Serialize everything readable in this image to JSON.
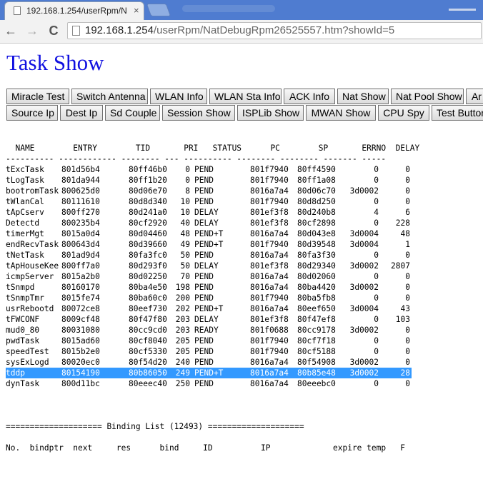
{
  "browser": {
    "tab_title": "192.168.1.254/userRpm/N",
    "tab_close": "×",
    "url_host": "192.168.1.254",
    "url_path": "/userRpm/NatDebugRpm26525557.htm?showId=5",
    "back_glyph": "←",
    "forward_glyph": "→",
    "reload_glyph": "C"
  },
  "page": {
    "title": "Task Show",
    "buttons_row1": [
      "Miracle Test",
      "Switch Antenna",
      "WLAN Info",
      "WLAN Sta Info",
      "ACK Info",
      "Nat Show",
      "Nat Pool Show",
      "Ar"
    ],
    "buttons_row2": [
      "Source Ip",
      "Dest Ip",
      "Sd Couple",
      "Session Show",
      "ISPLib Show",
      "MWAN Show",
      "CPU Spy",
      "Test Button"
    ]
  },
  "task_table": {
    "header": "  NAME        ENTRY        TID       PRI   STATUS      PC        SP       ERRNO  DELAY",
    "separator": "---------- ------------ -------- --- ---------- -------- -------- ------- -----",
    "rows": [
      [
        "tExcTask",
        "801d56b4",
        "80ff46b0",
        "0",
        "PEND",
        "801f7940",
        "80ff4590",
        "0",
        "0"
      ],
      [
        "tLogTask",
        "801da944",
        "80ff1b20",
        "0",
        "PEND",
        "801f7940",
        "80ff1a08",
        "0",
        "0"
      ],
      [
        "bootromTask",
        "800625d0",
        "80d06e70",
        "8",
        "PEND",
        "8016a7a4",
        "80d06c70",
        "3d0002",
        "0"
      ],
      [
        "tWlanCal",
        "80111610",
        "80d8d340",
        "10",
        "PEND",
        "801f7940",
        "80d8d250",
        "0",
        "0"
      ],
      [
        "tApCserv",
        "800ff270",
        "80d241a0",
        "10",
        "DELAY",
        "801ef3f8",
        "80d240b8",
        "4",
        "6"
      ],
      [
        "Detectd",
        "800235b4",
        "80cf2920",
        "40",
        "DELAY",
        "801ef3f8",
        "80cf2898",
        "0",
        "228"
      ],
      [
        "timerMgt",
        "8015a0d4",
        "80d04460",
        "48",
        "PEND+T",
        "8016a7a4",
        "80d043e8",
        "3d0004",
        "48"
      ],
      [
        "endRecvTask",
        "800643d4",
        "80d39660",
        "49",
        "PEND+T",
        "801f7940",
        "80d39548",
        "3d0004",
        "1"
      ],
      [
        "tNetTask",
        "801ad9d4",
        "80fa3fc0",
        "50",
        "PEND",
        "8016a7a4",
        "80fa3f30",
        "0",
        "0"
      ],
      [
        "tApHouseKee",
        "800ff7a0",
        "80d293f0",
        "50",
        "DELAY",
        "801ef3f8",
        "80d29340",
        "3d0002",
        "2807"
      ],
      [
        "icmpServer",
        "8015a2b0",
        "80d02250",
        "70",
        "PEND",
        "8016a7a4",
        "80d02060",
        "0",
        "0"
      ],
      [
        "tSnmpd",
        "80160170",
        "80ba4e50",
        "198",
        "PEND",
        "8016a7a4",
        "80ba4420",
        "3d0002",
        "0"
      ],
      [
        "tSnmpTmr",
        "8015fe74",
        "80ba60c0",
        "200",
        "PEND",
        "801f7940",
        "80ba5fb8",
        "0",
        "0"
      ],
      [
        "usrRebootd",
        "80072ce8",
        "80eef730",
        "202",
        "PEND+T",
        "8016a7a4",
        "80eef650",
        "3d0004",
        "43"
      ],
      [
        "tFWCONF",
        "8009cf48",
        "80f47f80",
        "203",
        "DELAY",
        "801ef3f8",
        "80f47ef8",
        "0",
        "103"
      ],
      [
        "mud0_80",
        "80031080",
        "80cc9cd0",
        "203",
        "READY",
        "801f0688",
        "80cc9178",
        "3d0002",
        "0"
      ],
      [
        "pwdTask",
        "8015ad60",
        "80cf8040",
        "205",
        "PEND",
        "801f7940",
        "80cf7f18",
        "0",
        "0"
      ],
      [
        "speedTest",
        "8015b2e0",
        "80cf5330",
        "205",
        "PEND",
        "801f7940",
        "80cf5188",
        "0",
        "0"
      ],
      [
        "sysExLogd",
        "80020ec0",
        "80f54d20",
        "240",
        "PEND",
        "8016a7a4",
        "80f54908",
        "3d0002",
        "0"
      ],
      [
        "tddp",
        "80154190",
        "80b86050",
        "249",
        "PEND+T",
        "8016a7a4",
        "80b85e48",
        "3d0002",
        "28"
      ],
      [
        "dynTask",
        "800d11bc",
        "80eeec40",
        "250",
        "PEND",
        "8016a7a4",
        "80eeebc0",
        "0",
        "0"
      ]
    ],
    "selected_row": 19
  },
  "binding": {
    "title_line": "==================== Binding List (12493) ====================",
    "header_line": "No.  bindptr  next     res      bind     ID          IP             expire temp   F"
  }
}
